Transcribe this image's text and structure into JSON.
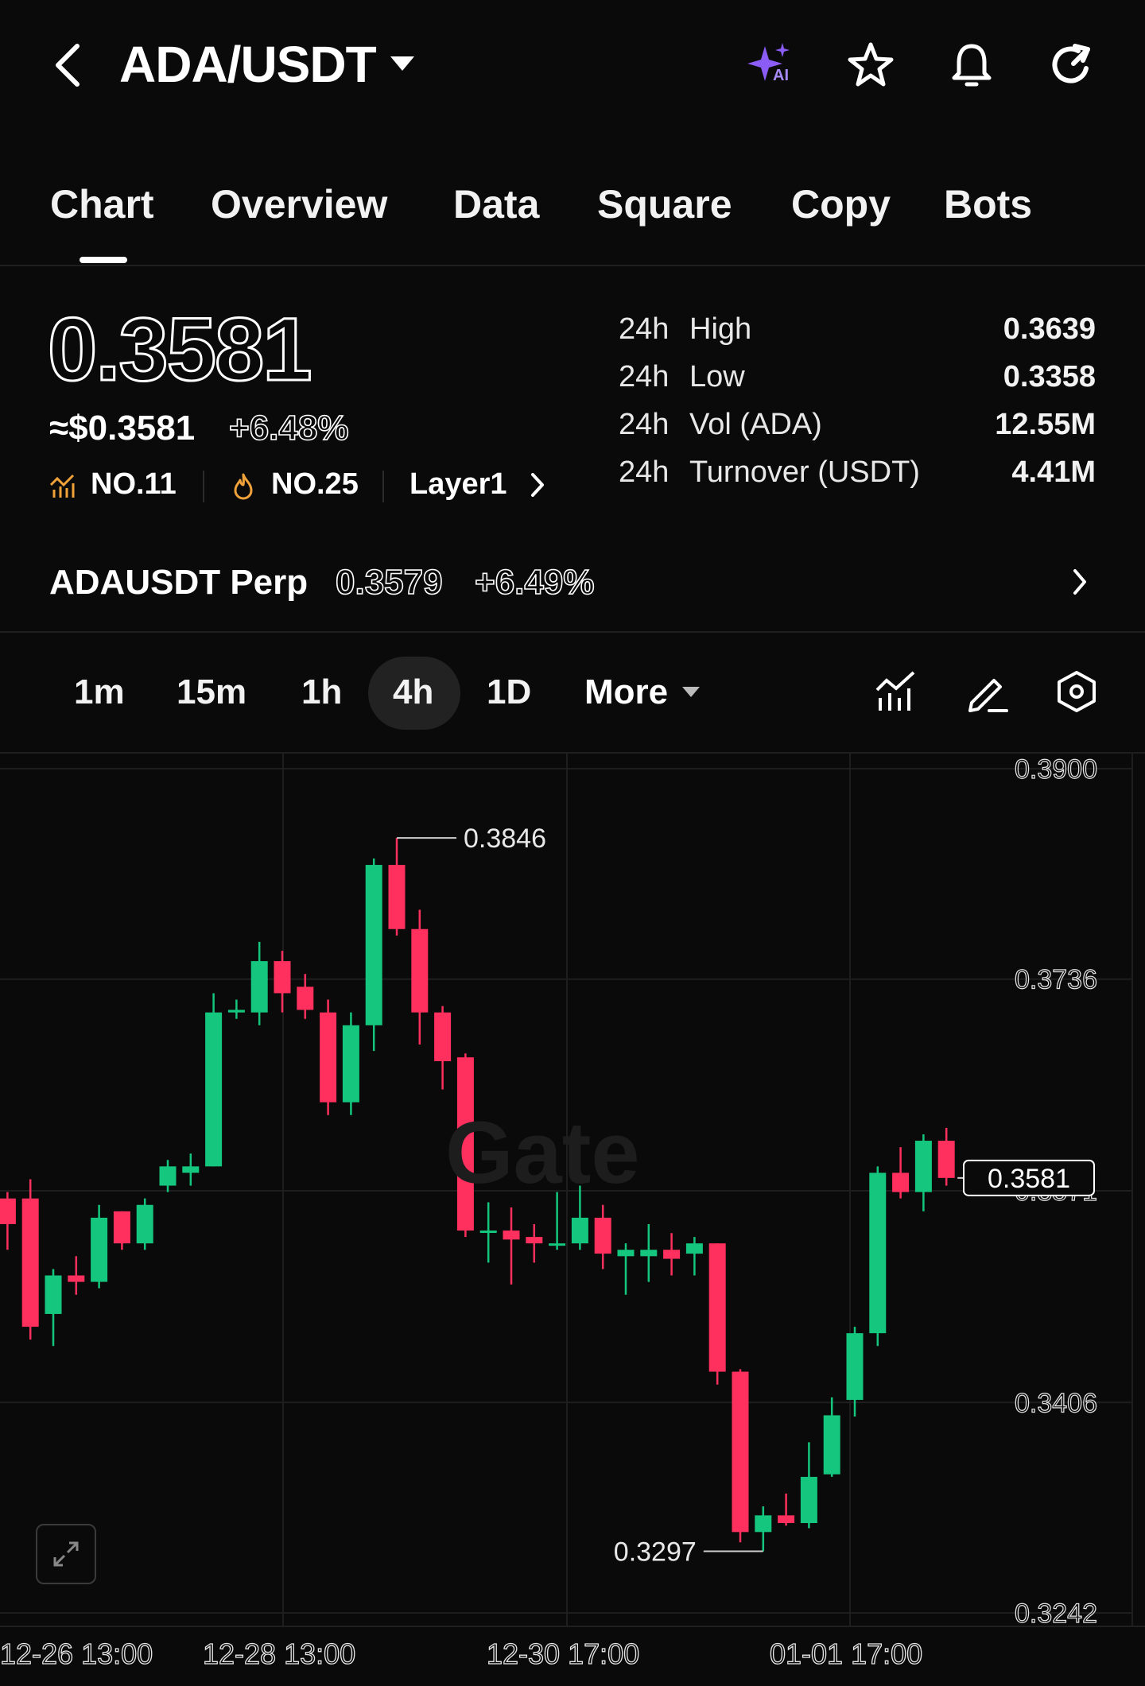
{
  "header": {
    "pair": "ADA/USDT",
    "ai_badge": "AI"
  },
  "tabs": [
    "Chart",
    "Overview",
    "Data",
    "Square",
    "Copy",
    "Bots"
  ],
  "active_tab": "Chart",
  "price": {
    "last": "0.3581",
    "usd_equiv": "≈$0.3581",
    "change": "+6.48%",
    "rank_market": "NO.11",
    "rank_hot": "NO.25",
    "sector": "Layer1"
  },
  "stats": [
    {
      "prefix": "24h",
      "label": "High",
      "value": "0.3639"
    },
    {
      "prefix": "24h",
      "label": "Low",
      "value": "0.3358"
    },
    {
      "prefix": "24h",
      "label": "Vol (ADA)",
      "value": "12.55M"
    },
    {
      "prefix": "24h",
      "label": "Turnover (USDT)",
      "value": "4.41M"
    }
  ],
  "perp": {
    "name": "ADAUSDT Perp",
    "price": "0.3579",
    "change": "+6.49%"
  },
  "timeframes": [
    "1m",
    "15m",
    "1h",
    "4h",
    "1D"
  ],
  "active_timeframe": "4h",
  "more_label": "More",
  "colors": {
    "up": "#15c77e",
    "down": "#ff2f5e",
    "background": "#0a0a0a",
    "ai_accent": "#8b5cf6",
    "rank_icon": "#f0a23a"
  },
  "chart_data": {
    "type": "candlestick",
    "watermark": "Gate",
    "y_ticks": [
      "0.3900",
      "0.3736",
      "0.3571",
      "0.3406",
      "0.3242"
    ],
    "ylim": [
      0.3242,
      0.39
    ],
    "x_ticks": [
      "12-26 13:00",
      "12-28 13:00",
      "12-30 17:00",
      "01-01 17:00"
    ],
    "high_marker": "0.3846",
    "low_marker": "0.3297",
    "current_price_label": "0.3581",
    "candles": [
      {
        "o": 0.3565,
        "h": 0.357,
        "l": 0.3525,
        "c": 0.3545
      },
      {
        "o": 0.3565,
        "h": 0.358,
        "l": 0.3455,
        "c": 0.3465
      },
      {
        "o": 0.3475,
        "h": 0.351,
        "l": 0.345,
        "c": 0.3505
      },
      {
        "o": 0.3505,
        "h": 0.352,
        "l": 0.349,
        "c": 0.35
      },
      {
        "o": 0.35,
        "h": 0.356,
        "l": 0.3495,
        "c": 0.355
      },
      {
        "o": 0.3555,
        "h": 0.3555,
        "l": 0.3525,
        "c": 0.353
      },
      {
        "o": 0.353,
        "h": 0.3565,
        "l": 0.3525,
        "c": 0.356
      },
      {
        "o": 0.3575,
        "h": 0.3595,
        "l": 0.357,
        "c": 0.359
      },
      {
        "o": 0.3585,
        "h": 0.36,
        "l": 0.3575,
        "c": 0.359
      },
      {
        "o": 0.359,
        "h": 0.3725,
        "l": 0.359,
        "c": 0.371
      },
      {
        "o": 0.371,
        "h": 0.372,
        "l": 0.3705,
        "c": 0.3712
      },
      {
        "o": 0.371,
        "h": 0.3765,
        "l": 0.37,
        "c": 0.375
      },
      {
        "o": 0.375,
        "h": 0.3758,
        "l": 0.371,
        "c": 0.3725
      },
      {
        "o": 0.373,
        "h": 0.374,
        "l": 0.3705,
        "c": 0.3712
      },
      {
        "o": 0.371,
        "h": 0.372,
        "l": 0.363,
        "c": 0.364
      },
      {
        "o": 0.364,
        "h": 0.371,
        "l": 0.363,
        "c": 0.37
      },
      {
        "o": 0.37,
        "h": 0.383,
        "l": 0.368,
        "c": 0.3825
      },
      {
        "o": 0.3825,
        "h": 0.3846,
        "l": 0.377,
        "c": 0.3775
      },
      {
        "o": 0.3775,
        "h": 0.379,
        "l": 0.3685,
        "c": 0.371
      },
      {
        "o": 0.371,
        "h": 0.3715,
        "l": 0.365,
        "c": 0.3672
      },
      {
        "o": 0.3675,
        "h": 0.3678,
        "l": 0.3535,
        "c": 0.354
      },
      {
        "o": 0.354,
        "h": 0.3562,
        "l": 0.3515,
        "c": 0.354
      },
      {
        "o": 0.354,
        "h": 0.3558,
        "l": 0.3498,
        "c": 0.3533
      },
      {
        "o": 0.3535,
        "h": 0.3545,
        "l": 0.3515,
        "c": 0.353
      },
      {
        "o": 0.353,
        "h": 0.357,
        "l": 0.3525,
        "c": 0.353
      },
      {
        "o": 0.353,
        "h": 0.3575,
        "l": 0.3525,
        "c": 0.355
      },
      {
        "o": 0.355,
        "h": 0.356,
        "l": 0.351,
        "c": 0.3522
      },
      {
        "o": 0.352,
        "h": 0.353,
        "l": 0.349,
        "c": 0.3525
      },
      {
        "o": 0.352,
        "h": 0.3545,
        "l": 0.35,
        "c": 0.3525
      },
      {
        "o": 0.3525,
        "h": 0.3538,
        "l": 0.3505,
        "c": 0.3518
      },
      {
        "o": 0.3522,
        "h": 0.3535,
        "l": 0.3505,
        "c": 0.353
      },
      {
        "o": 0.353,
        "h": 0.353,
        "l": 0.342,
        "c": 0.343
      },
      {
        "o": 0.343,
        "h": 0.3432,
        "l": 0.3297,
        "c": 0.3305
      },
      {
        "o": 0.3305,
        "h": 0.3325,
        "l": 0.329,
        "c": 0.3318
      },
      {
        "o": 0.3318,
        "h": 0.3335,
        "l": 0.331,
        "c": 0.3312
      },
      {
        "o": 0.3312,
        "h": 0.3375,
        "l": 0.3308,
        "c": 0.3348
      },
      {
        "o": 0.335,
        "h": 0.341,
        "l": 0.3348,
        "c": 0.3396
      },
      {
        "o": 0.3408,
        "h": 0.3465,
        "l": 0.3395,
        "c": 0.346
      },
      {
        "o": 0.346,
        "h": 0.359,
        "l": 0.345,
        "c": 0.3585
      },
      {
        "o": 0.3585,
        "h": 0.3605,
        "l": 0.3565,
        "c": 0.357
      },
      {
        "o": 0.357,
        "h": 0.3615,
        "l": 0.3555,
        "c": 0.361
      },
      {
        "o": 0.361,
        "h": 0.362,
        "l": 0.3575,
        "c": 0.3581
      }
    ]
  }
}
